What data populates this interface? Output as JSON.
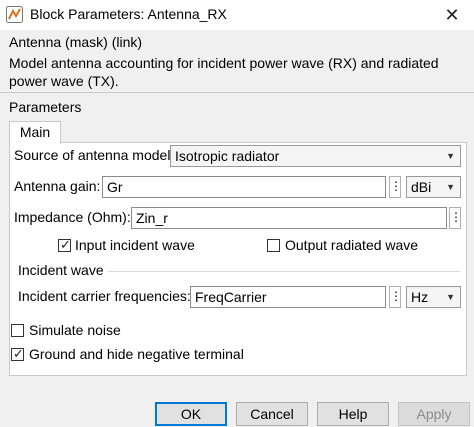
{
  "window": {
    "title": "Block Parameters: Antenna_RX",
    "close_glyph": "✕"
  },
  "mask": {
    "title": "Antenna (mask) (link)",
    "description": "Model antenna accounting for incident power wave (RX) and radiated power wave (TX)."
  },
  "parameters": {
    "label": "Parameters",
    "tabs": [
      {
        "label": "Main",
        "active": true
      }
    ],
    "source_model": {
      "label": "Source of antenna model:",
      "value": "Isotropic radiator"
    },
    "antenna_gain": {
      "label": "Antenna gain:",
      "value": "Gr",
      "unit": "dBi"
    },
    "impedance": {
      "label": "Impedance (Ohm):",
      "value": "Zin_r"
    },
    "input_incident_wave": {
      "label": "Input incident wave",
      "checked": true
    },
    "output_radiated_wave": {
      "label": "Output radiated wave",
      "checked": false
    },
    "incident_wave_group": {
      "label": "Incident wave"
    },
    "carrier_frequencies": {
      "label": "Incident carrier frequencies:",
      "value": "FreqCarrier",
      "unit": "Hz"
    },
    "simulate_noise": {
      "label": "Simulate noise",
      "checked": false
    },
    "ground_terminal": {
      "label": "Ground and hide negative terminal",
      "checked": true
    }
  },
  "buttons": {
    "ok": "OK",
    "cancel": "Cancel",
    "help": "Help",
    "apply": "Apply"
  },
  "colors": {
    "accent": "#0078d7",
    "app_icon": "#e07020"
  }
}
